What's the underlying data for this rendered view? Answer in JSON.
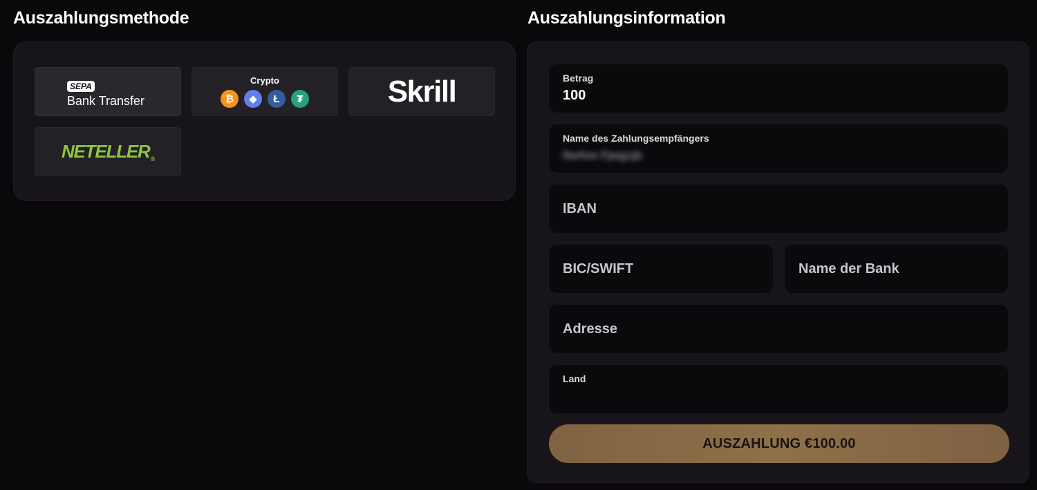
{
  "method_section": {
    "title": "Auszahlungsmethode",
    "methods": [
      {
        "id": "sepa",
        "badge": "SEPA",
        "label": "Bank Transfer"
      },
      {
        "id": "crypto",
        "label": "Crypto",
        "coins": [
          "₿",
          "◆",
          "Ł",
          "₮"
        ]
      },
      {
        "id": "skrill",
        "label": "Skrill"
      },
      {
        "id": "neteller",
        "label": "NETELLER",
        "mark": "®"
      }
    ]
  },
  "info_section": {
    "title": "Auszahlungsinformation",
    "fields": {
      "betrag": {
        "label": "Betrag",
        "value": "100"
      },
      "recipient": {
        "label": "Name des Zahlungsempfängers",
        "value": "Nwfvw Fjwgxjb"
      },
      "iban": {
        "placeholder": "IBAN"
      },
      "bic": {
        "placeholder": "BIC/SWIFT"
      },
      "bank": {
        "placeholder": "Name der Bank"
      },
      "adresse": {
        "placeholder": "Adresse"
      },
      "land": {
        "label": "Land",
        "value": ""
      }
    },
    "submit_label": "AUSZAHLUNG €100.00"
  },
  "colors": {
    "background": "#0a080b",
    "panel": "#18151a",
    "field": "#0b090c",
    "button": "#8e7049",
    "neteller_green": "#8dc63f"
  }
}
